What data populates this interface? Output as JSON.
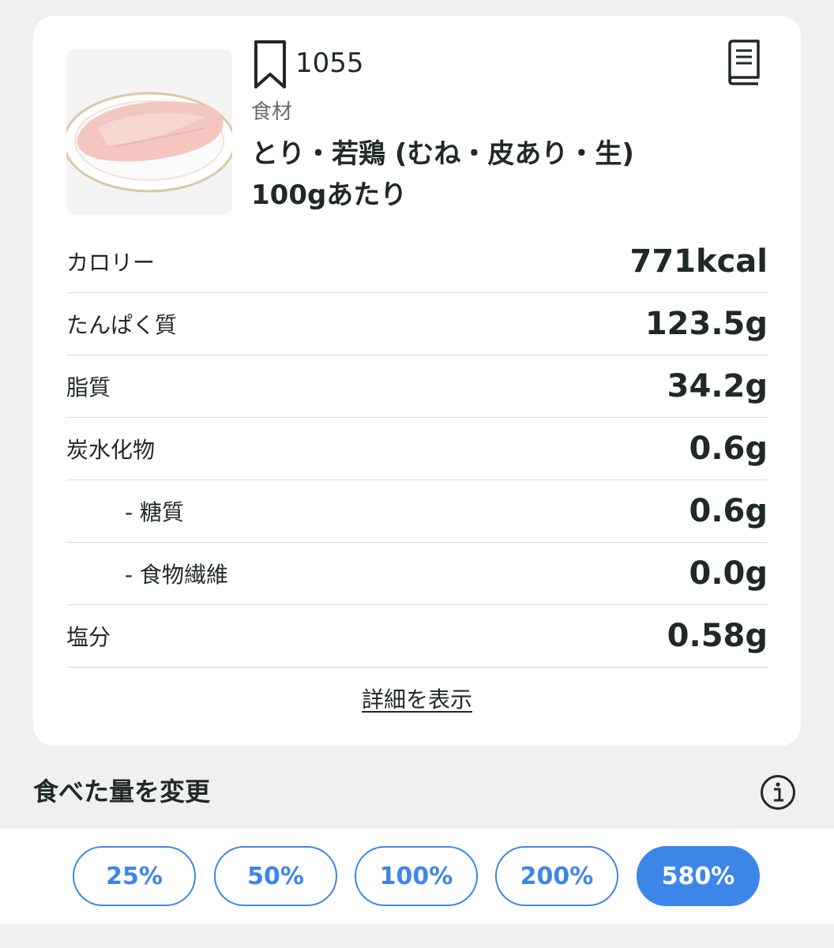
{
  "food": {
    "bookmark_count": "1055",
    "category": "食材",
    "name": "とり・若鶏 (むね・皮あり・生)",
    "per_unit": "100gあたり"
  },
  "nutrients": [
    {
      "label": "カロリー",
      "value": "771kcal",
      "sub": false
    },
    {
      "label": "たんぱく質",
      "value": "123.5g",
      "sub": false
    },
    {
      "label": "脂質",
      "value": "34.2g",
      "sub": false
    },
    {
      "label": "炭水化物",
      "value": "0.6g",
      "sub": false
    },
    {
      "label": "- 糖質",
      "value": "0.6g",
      "sub": true
    },
    {
      "label": "- 食物繊維",
      "value": "0.0g",
      "sub": true
    },
    {
      "label": "塩分",
      "value": "0.58g",
      "sub": false
    }
  ],
  "details_link": "詳細を表示",
  "portion_section": {
    "title": "食べた量を変更"
  },
  "portion_options": [
    {
      "label": "25%",
      "selected": false
    },
    {
      "label": "50%",
      "selected": false
    },
    {
      "label": "100%",
      "selected": false
    },
    {
      "label": "200%",
      "selected": false
    },
    {
      "label": "580%",
      "selected": true
    }
  ],
  "colors": {
    "accent": "#3d86e8",
    "text": "#1f2a22",
    "background": "#f0f0f0"
  },
  "icons": {
    "bookmark": "bookmark-icon",
    "book": "book-icon",
    "info": "info-icon"
  }
}
